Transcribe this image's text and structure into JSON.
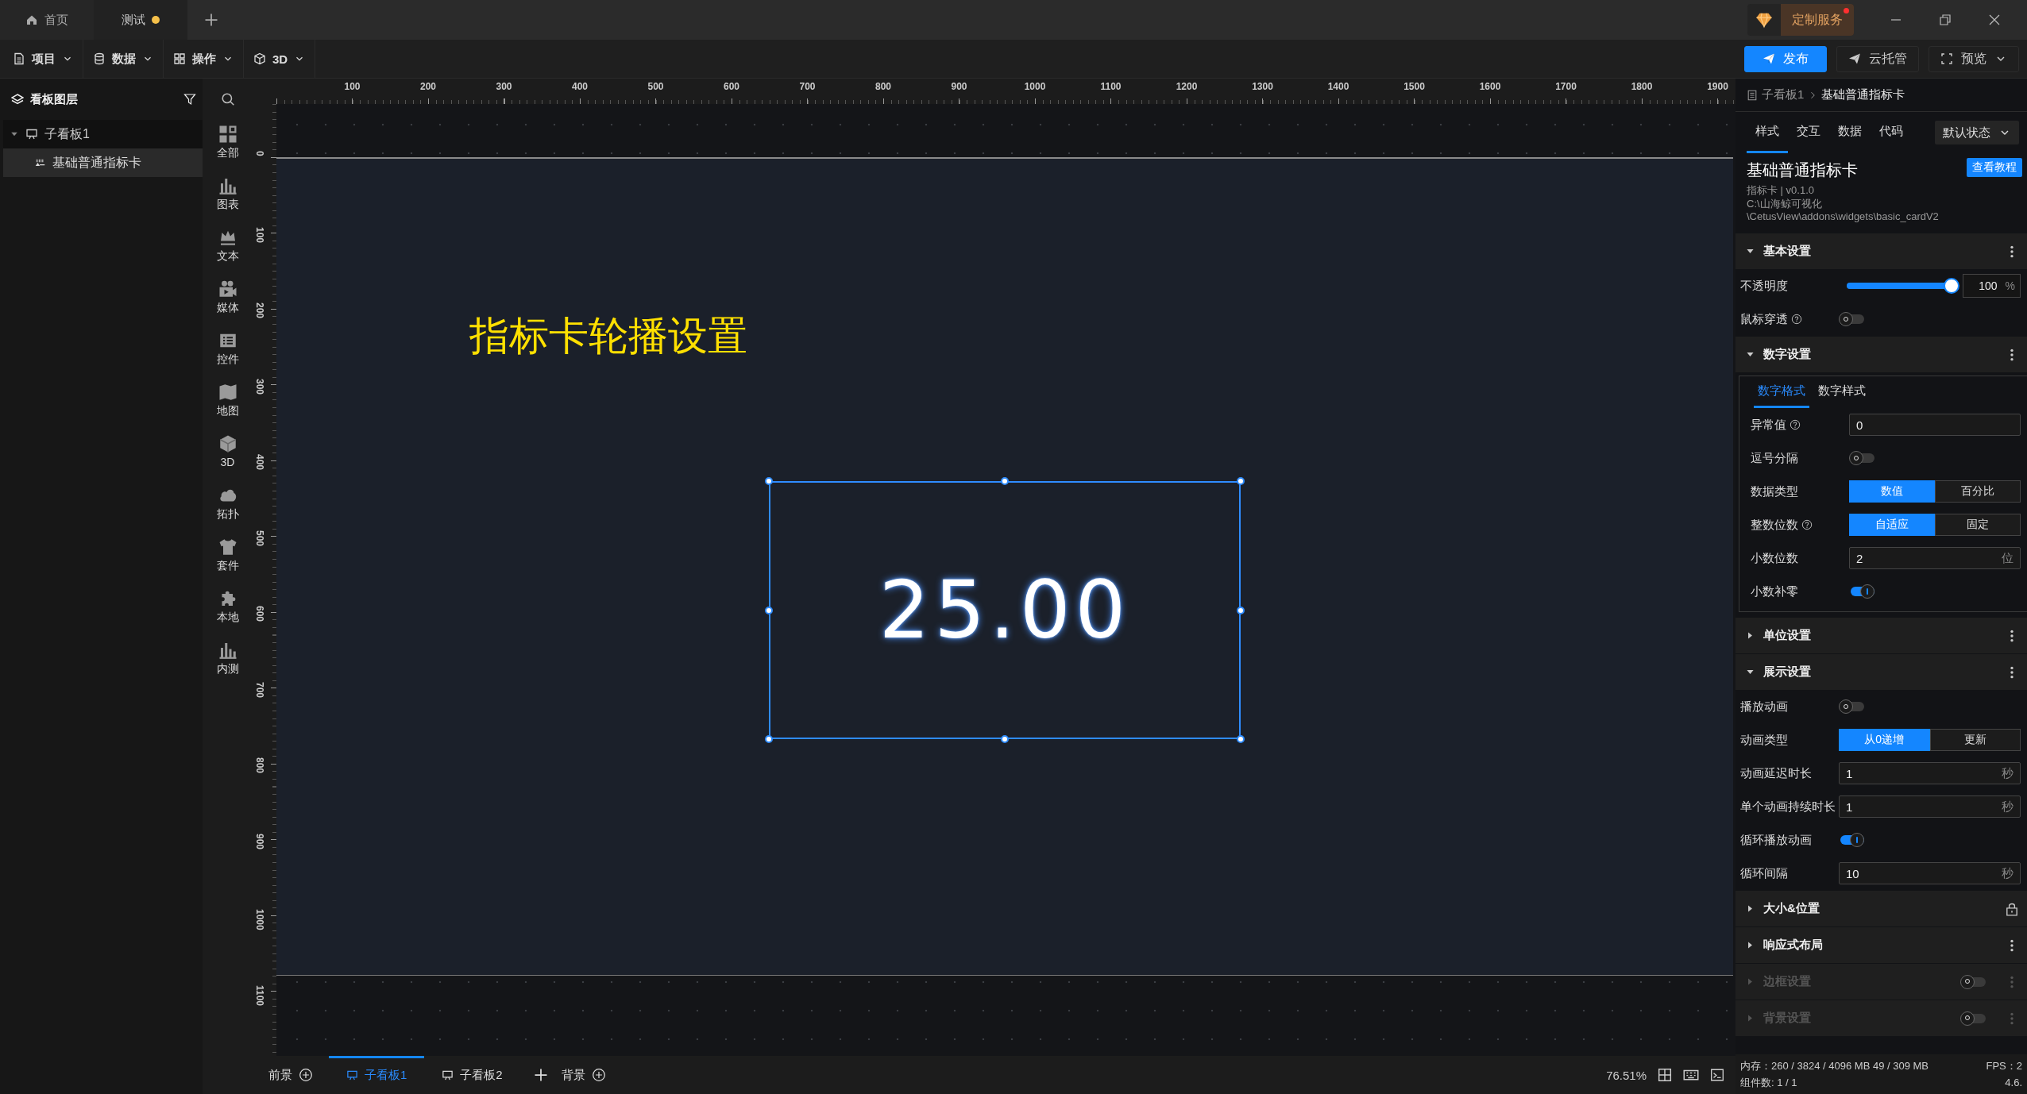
{
  "tabs": [
    {
      "label": "首页",
      "kind": "home",
      "selected": false,
      "modified": false
    },
    {
      "label": "测试",
      "kind": "document",
      "selected": true,
      "modified": true
    }
  ],
  "service": {
    "label": "定制服务",
    "notification": true
  },
  "menu": [
    {
      "label": "项目"
    },
    {
      "label": "数据"
    },
    {
      "label": "操作"
    },
    {
      "label": "3D"
    }
  ],
  "actions": [
    {
      "label": "发布",
      "kind": "primary"
    },
    {
      "label": "云托管",
      "kind": "plain"
    },
    {
      "label": "预览",
      "kind": "dropdown"
    }
  ],
  "layers": {
    "title": "看板图层",
    "tree": [
      {
        "label": "子看板1",
        "expanded": true,
        "selected": false,
        "children": [
          {
            "label": "基础普通指标卡",
            "selected": true
          }
        ]
      }
    ]
  },
  "widget_categories": [
    {
      "label": "全部"
    },
    {
      "label": "图表"
    },
    {
      "label": "文本"
    },
    {
      "label": "媒体"
    },
    {
      "label": "控件"
    },
    {
      "label": "地图"
    },
    {
      "label": "3D"
    },
    {
      "label": "拓扑"
    },
    {
      "label": "套件"
    },
    {
      "label": "本地"
    },
    {
      "label": "内测"
    }
  ],
  "ruler": {
    "x_labels": [
      "100",
      "200",
      "300",
      "400",
      "500",
      "600",
      "700",
      "800",
      "900",
      "1000",
      "1100",
      "1200",
      "1300",
      "1400",
      "1500",
      "1600",
      "1700",
      "1800",
      "1900"
    ],
    "y_labels": [
      "0",
      "100",
      "200",
      "300",
      "400",
      "500",
      "600",
      "700",
      "800",
      "900",
      "1000",
      "1100"
    ]
  },
  "canvas": {
    "title_text": "指标卡轮播设置",
    "metric_value": "25.00",
    "widget_selected": true
  },
  "bottom_bar": {
    "foreground": "前景",
    "boards": [
      {
        "label": "子看板1",
        "selected": true
      },
      {
        "label": "子看板2",
        "selected": false
      }
    ],
    "background": "背景",
    "zoom": "76.51%"
  },
  "inspector": {
    "breadcrumb": {
      "parent": "子看板1",
      "current": "基础普通指标卡"
    },
    "tabs": [
      {
        "label": "样式",
        "selected": true
      },
      {
        "label": "交互",
        "selected": false
      },
      {
        "label": "数据",
        "selected": false
      },
      {
        "label": "代码",
        "selected": false
      }
    ],
    "state_select": "默认状态",
    "widget": {
      "name": "基础普通指标卡",
      "meta": "指标卡 | v0.1.0",
      "path_lines": [
        "C:\\山海鲸可视化",
        "\\CetusView\\addons\\widgets\\basic_cardV2"
      ],
      "tutorial_button": "查看教程"
    },
    "sections": [
      {
        "title": "基本设置",
        "expanded": true,
        "disabled": false,
        "rows": [
          {
            "kind": "slider",
            "label": "不透明度",
            "level": 1.0,
            "value": "100",
            "unit": "%"
          },
          {
            "kind": "switch",
            "label": "鼠标穿透",
            "help": true,
            "on": false
          }
        ]
      },
      {
        "title": "数字设置",
        "expanded": true,
        "disabled": false,
        "subtabs": [
          {
            "label": "数字格式",
            "selected": true
          },
          {
            "label": "数字样式",
            "selected": false
          }
        ],
        "rows": [
          {
            "kind": "input",
            "label": "异常值",
            "help": true,
            "value": "0"
          },
          {
            "kind": "switch",
            "label": "逗号分隔",
            "on": false
          },
          {
            "kind": "segmented",
            "label": "数据类型",
            "options": [
              {
                "label": "数值",
                "selected": true
              },
              {
                "label": "百分比",
                "selected": false
              }
            ]
          },
          {
            "kind": "segmented",
            "label": "整数位数",
            "help": true,
            "options": [
              {
                "label": "自适应",
                "selected": true
              },
              {
                "label": "固定",
                "selected": false
              }
            ]
          },
          {
            "kind": "input",
            "label": "小数位数",
            "value": "2",
            "unit": "位"
          },
          {
            "kind": "switch",
            "label": "小数补零",
            "on": true
          }
        ]
      },
      {
        "title": "单位设置",
        "expanded": false,
        "disabled": false
      },
      {
        "title": "展示设置",
        "expanded": true,
        "disabled": false,
        "rows": [
          {
            "kind": "switch",
            "label": "播放动画",
            "on": false
          },
          {
            "kind": "segmented",
            "label": "动画类型",
            "options": [
              {
                "label": "从0递增",
                "selected": true
              },
              {
                "label": "更新",
                "selected": false
              }
            ]
          },
          {
            "kind": "input",
            "label": "动画延迟时长",
            "value": "1",
            "unit": "秒"
          },
          {
            "kind": "input",
            "label": "单个动画持续时长",
            "value": "1",
            "unit": "秒"
          },
          {
            "kind": "switch",
            "label": "循环播放动画",
            "on": true
          },
          {
            "kind": "input",
            "label": "循环间隔",
            "value": "10",
            "unit": "秒"
          }
        ]
      },
      {
        "title": "大小&位置",
        "expanded": false,
        "disabled": false
      },
      {
        "title": "响应式布局",
        "expanded": false,
        "disabled": false
      },
      {
        "title": "边框设置",
        "expanded": false,
        "disabled": true,
        "toggle_on": false
      },
      {
        "title": "背景设置",
        "expanded": false,
        "disabled": true,
        "toggle_on": false
      }
    ]
  },
  "status": {
    "memory": "内存：260 / 3824 / 4096 MB  49 / 309 MB",
    "fps": "FPS：2",
    "components": "组件数: 1 / 1",
    "version": "4.6."
  }
}
